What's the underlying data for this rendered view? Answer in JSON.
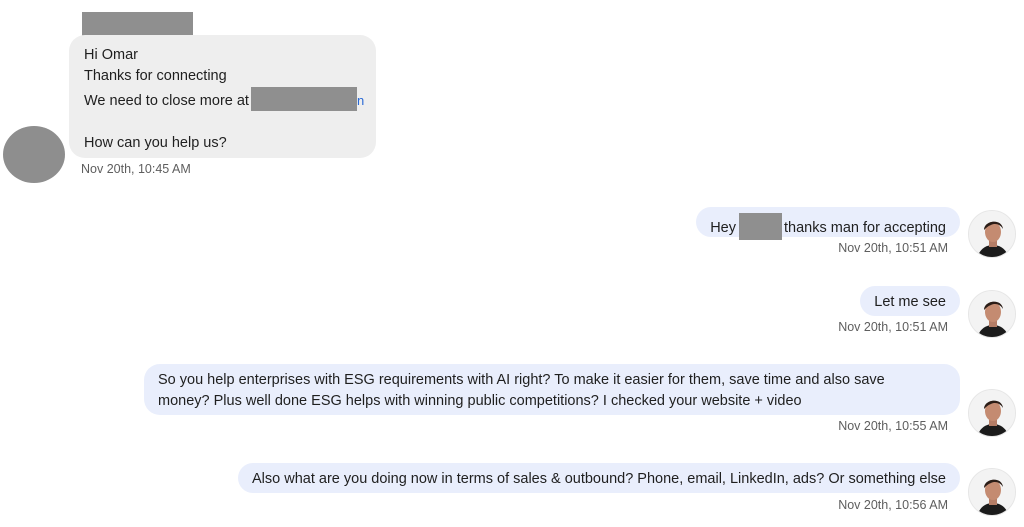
{
  "incoming": {
    "lines": [
      "Hi Omar",
      "Thanks for connecting",
      "We need to close more at",
      "How can you help us?"
    ],
    "link_tail": "n",
    "timestamp": "Nov 20th, 10:45 AM"
  },
  "outgoing": [
    {
      "before": "Hey",
      "after": "thanks man for accepting",
      "timestamp": "Nov 20th, 10:51 AM"
    },
    {
      "text": "Let me see",
      "timestamp": "Nov 20th, 10:51 AM"
    },
    {
      "lines": [
        "So you help enterprises with ESG requirements with AI right? To make it easier for them, save time and also save",
        "money? Plus well done ESG helps with winning public competitions? I checked your website + video"
      ],
      "timestamp": "Nov 20th, 10:55 AM"
    },
    {
      "text": "Also what are you doing now in terms of sales & outbound? Phone, email, LinkedIn, ads? Or something else",
      "timestamp": "Nov 20th, 10:56 AM"
    }
  ],
  "colors": {
    "incoming_bubble": "#eeeeee",
    "outgoing_bubble": "#e9eefc",
    "redaction": "#8f8f8f",
    "link": "#2a6ad6"
  },
  "icons": {
    "contact_avatar": "avatar-placeholder",
    "user_avatar": "user-photo-avatar"
  }
}
